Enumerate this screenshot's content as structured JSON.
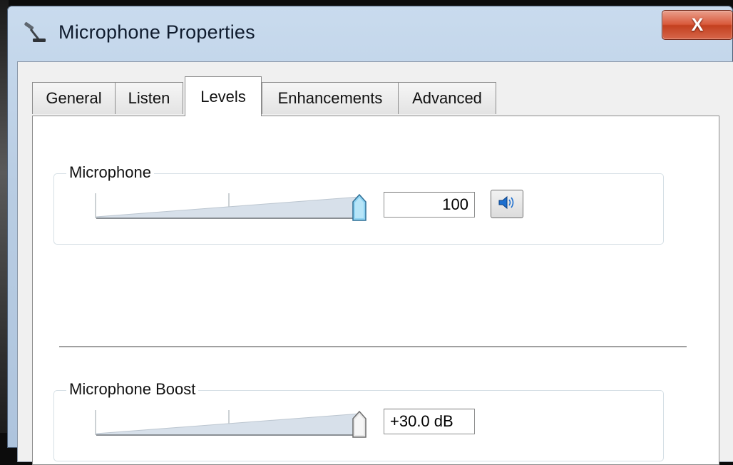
{
  "window": {
    "title": "Microphone Properties",
    "title_icon": "microphone-icon",
    "close_label": "X"
  },
  "tabs": [
    {
      "label": "General",
      "active": false
    },
    {
      "label": "Listen",
      "active": false
    },
    {
      "label": "Levels",
      "active": true
    },
    {
      "label": "Enhancements",
      "active": false
    },
    {
      "label": "Advanced",
      "active": false
    }
  ],
  "levels": {
    "microphone": {
      "label": "Microphone",
      "value": "100",
      "slider_fraction": 1.0,
      "mute_icon": "speaker-icon"
    },
    "boost": {
      "label": "Microphone Boost",
      "value": "+30.0 dB",
      "slider_fraction": 1.0
    }
  },
  "colors": {
    "title_bar": "#b9cde3",
    "close_button": "#c94a2d",
    "accent_thumb": "#7cc7ea"
  }
}
